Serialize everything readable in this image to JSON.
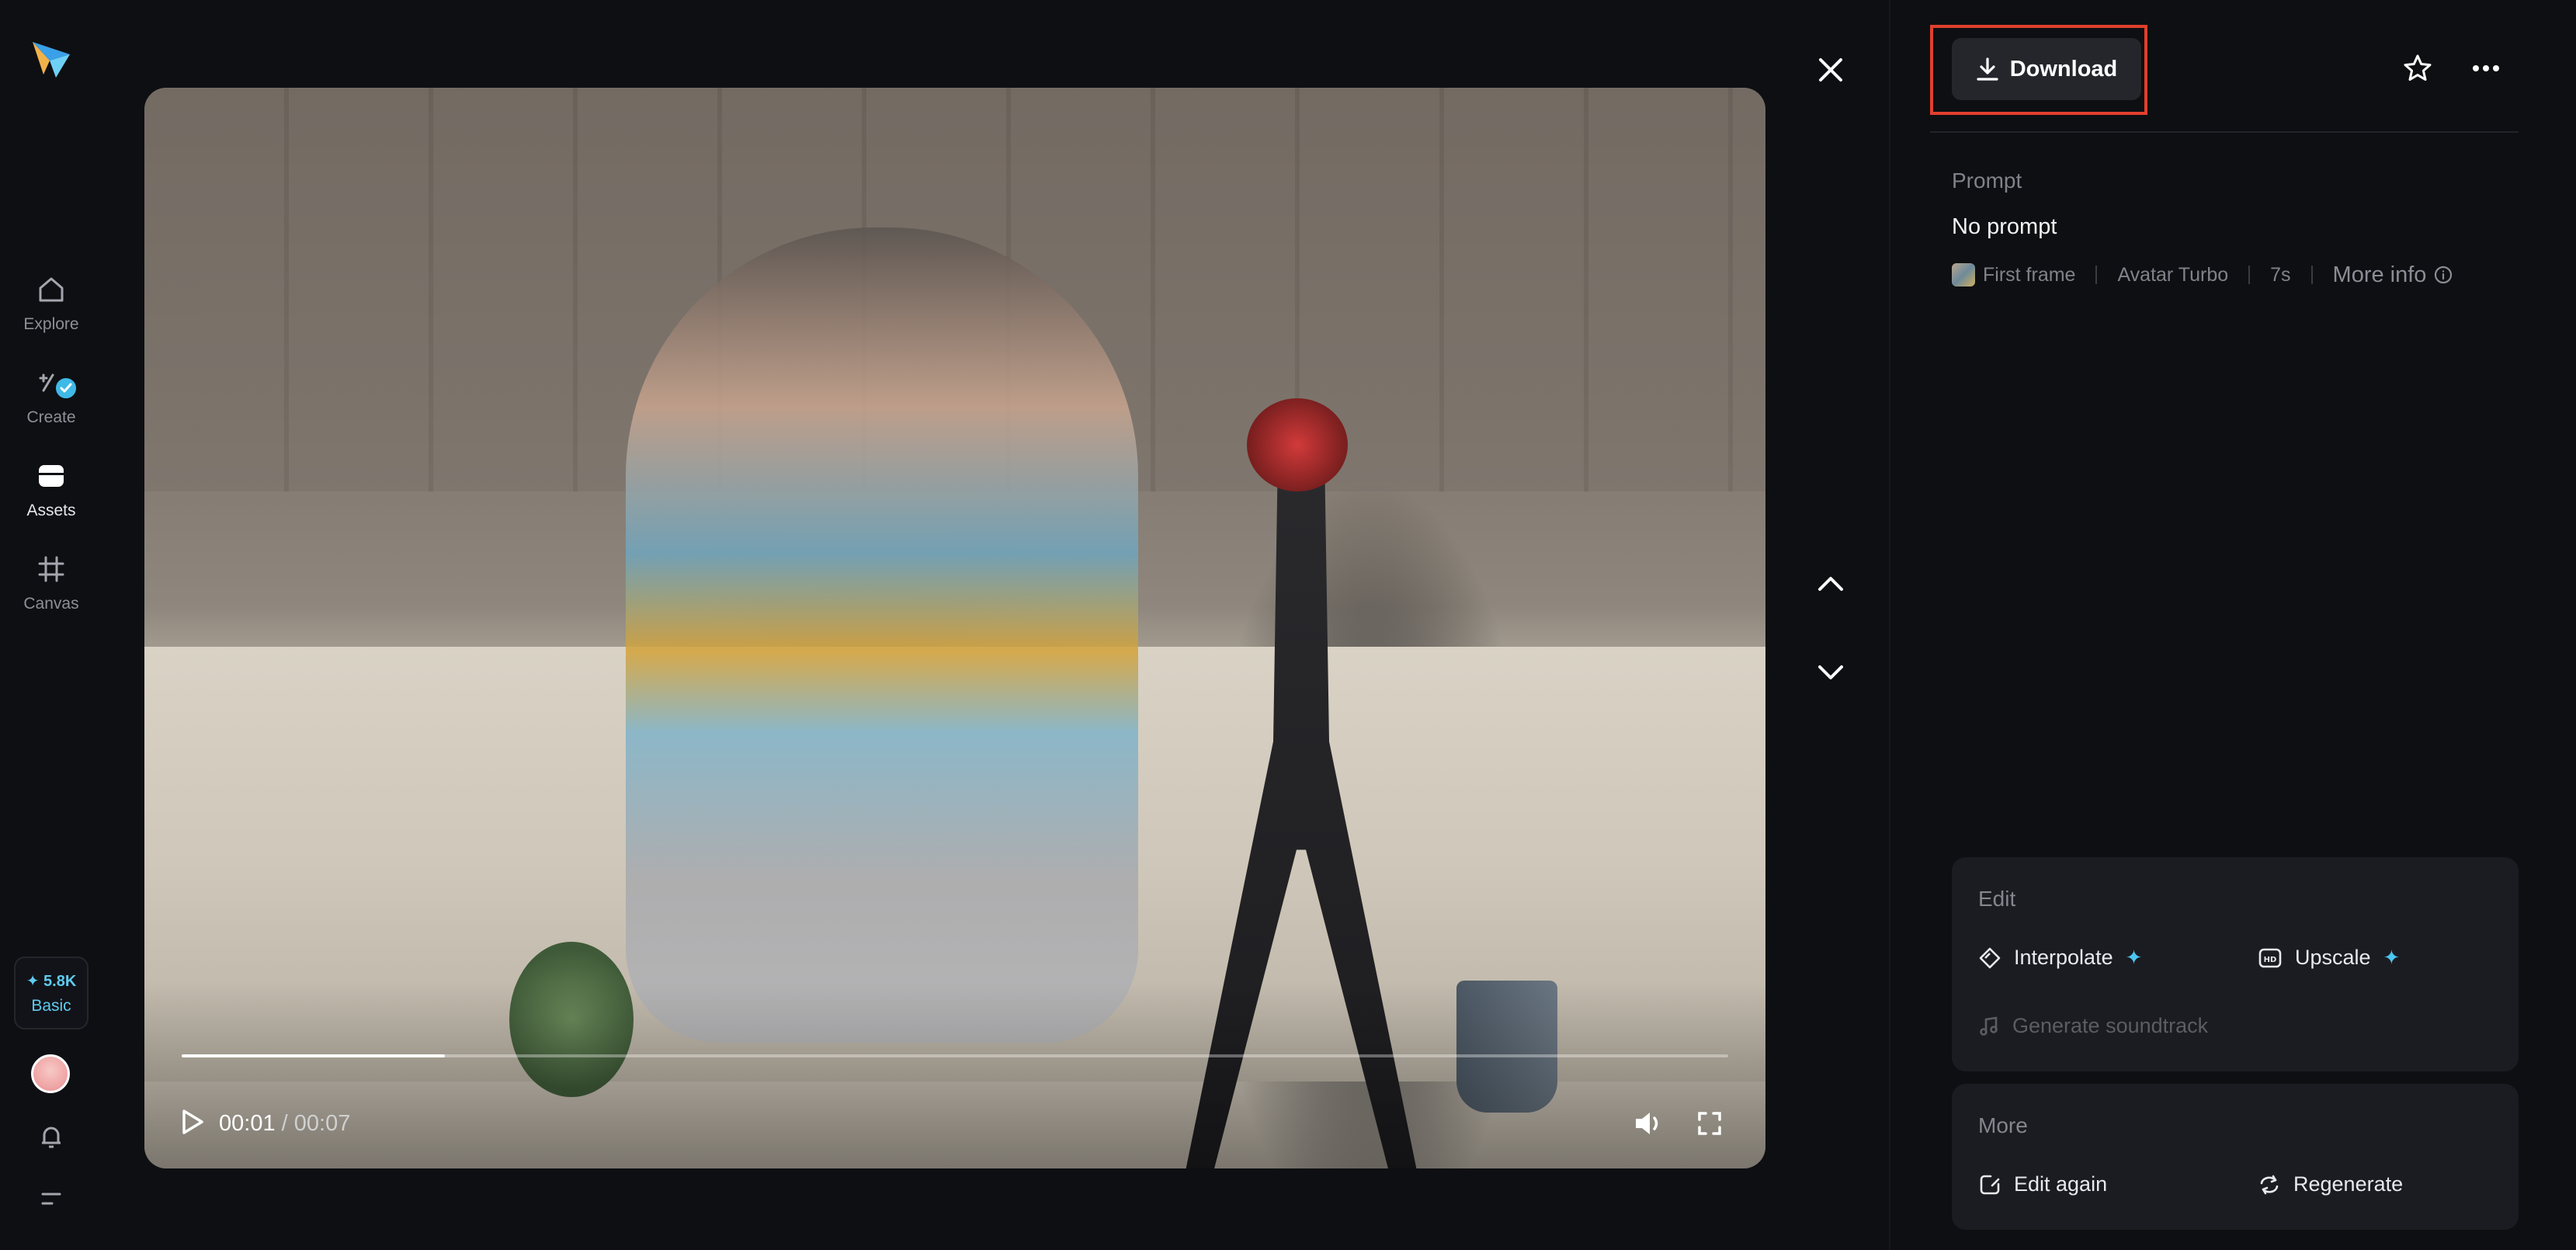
{
  "nav": {
    "items": [
      {
        "label": "Explore",
        "icon": "home-icon"
      },
      {
        "label": "Create",
        "icon": "create-icon"
      },
      {
        "label": "Assets",
        "icon": "folder-icon"
      },
      {
        "label": "Canvas",
        "icon": "crop-icon"
      }
    ],
    "active": "Assets",
    "credits": {
      "amount": "✦ 5.8K",
      "plan": "Basic"
    }
  },
  "player": {
    "current_time": "00:01",
    "duration": "/ 00:07",
    "progress_fraction": 0.17
  },
  "header": {
    "download_label": "Download"
  },
  "details": {
    "prompt_label": "Prompt",
    "prompt_text": "No prompt",
    "meta": {
      "first_frame": "First frame",
      "model": "Avatar Turbo",
      "duration": "7s",
      "more_info": "More info"
    }
  },
  "edit": {
    "title": "Edit",
    "interpolate": "Interpolate",
    "upscale": "Upscale",
    "soundtrack": "Generate soundtrack"
  },
  "more": {
    "title": "More",
    "edit_again": "Edit again",
    "regenerate": "Regenerate"
  },
  "colors": {
    "accent": "#4cc6f0",
    "highlight": "#e0402e",
    "background": "#0e0f12",
    "card": "#1b1c21"
  }
}
